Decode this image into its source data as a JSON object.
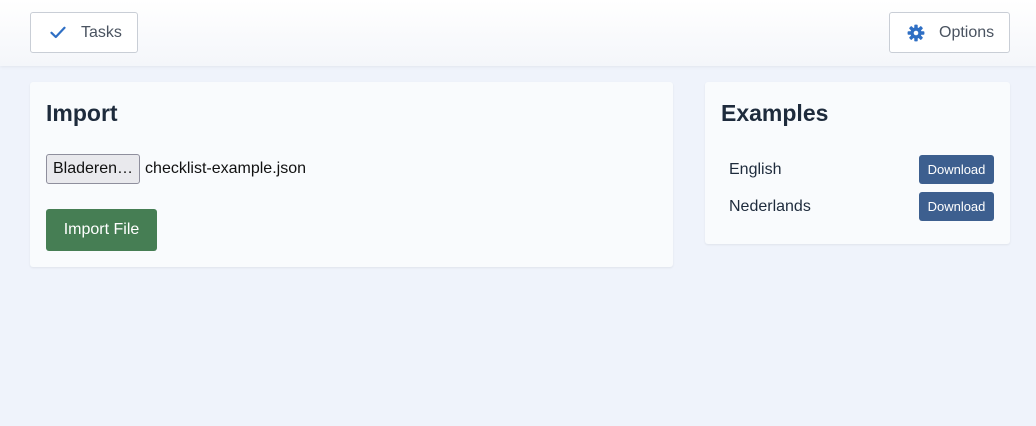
{
  "nav": {
    "tasks_label": "Tasks",
    "tasks_icon": "check-icon",
    "options_label": "Options",
    "options_icon": "gear-icon",
    "icon_color": "#2f6fc4"
  },
  "import": {
    "title": "Import",
    "browse_label": "Bladeren…",
    "file_name": "checklist-example.json",
    "import_button_label": "Import File",
    "import_button_color": "#467e54"
  },
  "examples": {
    "title": "Examples",
    "button_color": "#3d5f8f",
    "items": [
      {
        "label": "English",
        "download_label": "Download"
      },
      {
        "label": "Nederlands",
        "download_label": "Download"
      }
    ]
  }
}
